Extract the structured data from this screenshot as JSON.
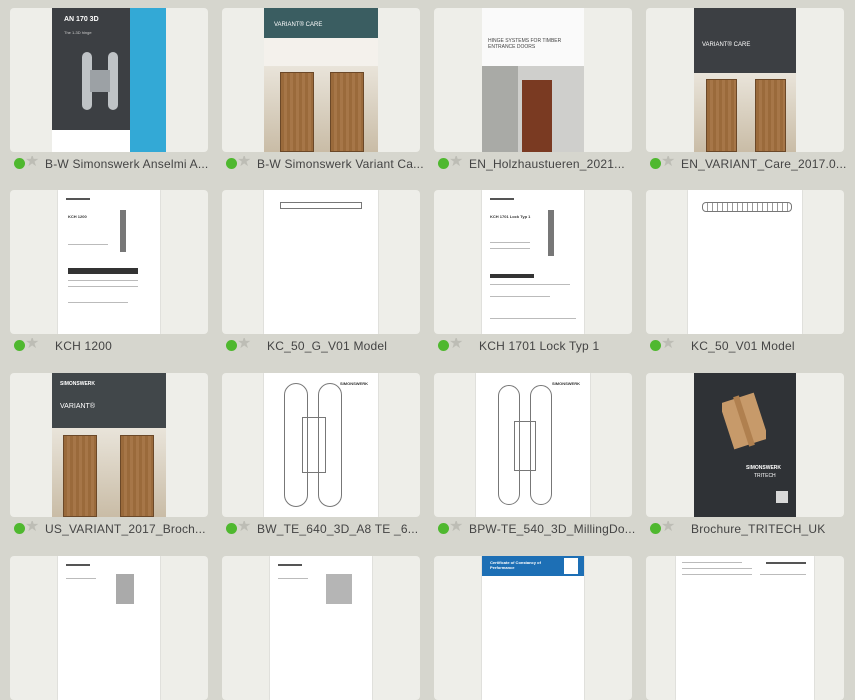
{
  "tiles": [
    {
      "name": "B-W Simonswerk Anselmi A...",
      "cover_title": "AN 170 3D",
      "cover_sub": "The 1-3D hinge"
    },
    {
      "name": "B-W Simonswerk Variant Ca...",
      "cover_title": "VARIANT® CARE"
    },
    {
      "name": "EN_Holzhaustueren_2021...",
      "cover_title": "HINGE SYSTEMS FOR TIMBER ENTRANCE DOORS"
    },
    {
      "name": "EN_VARIANT_Care_2017.0...",
      "cover_title": "VARIANT® CARE"
    },
    {
      "name": "KCH 1200",
      "cover_title": "KCH 1200"
    },
    {
      "name": "KC_50_G_V01 Model"
    },
    {
      "name": "KCH 1701 Lock Typ 1",
      "cover_title": "KCH 1701 Lock Typ 1"
    },
    {
      "name": "KC_50_V01 Model"
    },
    {
      "name": "US_VARIANT_2017_Broch...",
      "cover_title": "VARIANT®"
    },
    {
      "name": "BW_TE_640_3D_A8 TE _6..."
    },
    {
      "name": "BPW-TE_540_3D_MillingDo..."
    },
    {
      "name": "Brochure_TRITECH_UK",
      "cover_title": "TRITECH"
    },
    {
      "name": ""
    },
    {
      "name": ""
    },
    {
      "name": "",
      "cover_title": "Certificate of Constancy of Performance"
    },
    {
      "name": ""
    }
  ],
  "brand": "SIMONSWERK",
  "colors": {
    "status_green": "#4fb82f",
    "bg": "#d6d6ce",
    "tile": "#eeeee9",
    "accent_blue": "#33a9d6"
  }
}
